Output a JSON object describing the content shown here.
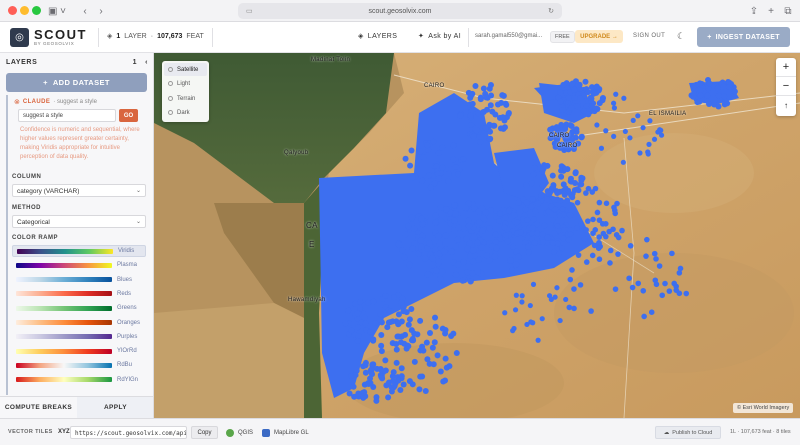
{
  "browser": {
    "url": "scout.geosolvix.com"
  },
  "header": {
    "app_name": "SCOUT",
    "app_sub": "BY GEOSOLVIX",
    "layer_count": "1",
    "layer_word": "LAYER",
    "feature_count": "107,673",
    "feature_word": "FEAT",
    "layers_link": "LAYERS",
    "ask_ai": "Ask by AI",
    "email": "sarah.gamal550@gmai...",
    "plan_badge": "FREE",
    "upgrade": "UPGRADE →",
    "sign_out": "SIGN OUT",
    "ingest": "INGEST DATASET"
  },
  "sidebar": {
    "title": "LAYERS",
    "count": "1",
    "add_dataset": "ADD DATASET",
    "claude_name": "CLAUDE",
    "claude_sub": "· suggest a style",
    "style_input": "suggest a style",
    "go": "GO",
    "claude_note": "Confidence is numeric and sequential, where higher values represent greater certainty, making Viridis appropriate for intuitive perception of data quality.",
    "column_label": "COLUMN",
    "column_value": "category (VARCHAR)",
    "method_label": "METHOD",
    "method_value": "Categorical",
    "ramp_label": "COLOR RAMP",
    "ramps": [
      {
        "name": "Viridis",
        "colors": [
          "#440154",
          "#3b528b",
          "#21918c",
          "#5ec962",
          "#fde725"
        ]
      },
      {
        "name": "Plasma",
        "colors": [
          "#0d0887",
          "#7e03a8",
          "#cc4778",
          "#f89540",
          "#f0f921"
        ]
      },
      {
        "name": "Blues",
        "colors": [
          "#eff3ff",
          "#bdd7e7",
          "#6baed6",
          "#3182bd",
          "#08519c"
        ]
      },
      {
        "name": "Reds",
        "colors": [
          "#fee5d9",
          "#fcae91",
          "#fb6a4a",
          "#de2d26",
          "#a50f15"
        ]
      },
      {
        "name": "Greens",
        "colors": [
          "#edf8e9",
          "#bae4b3",
          "#74c476",
          "#31a354",
          "#006d2c"
        ]
      },
      {
        "name": "Oranges",
        "colors": [
          "#feedde",
          "#fdbe85",
          "#fd8d3c",
          "#e6550d",
          "#a63603"
        ]
      },
      {
        "name": "Purples",
        "colors": [
          "#f2f0f7",
          "#cbc9e2",
          "#9e9ac8",
          "#756bb1",
          "#54278f"
        ]
      },
      {
        "name": "YlOrRd",
        "colors": [
          "#ffffb2",
          "#fecc5c",
          "#fd8d3c",
          "#f03b20",
          "#bd0026"
        ]
      },
      {
        "name": "RdBu",
        "colors": [
          "#ca0020",
          "#f4a582",
          "#f7f7f7",
          "#92c5de",
          "#0571b0"
        ]
      },
      {
        "name": "RdYlGn",
        "colors": [
          "#d7191c",
          "#fdae61",
          "#ffffbf",
          "#a6d96a",
          "#1a9641"
        ]
      }
    ],
    "compute_breaks": "COMPUTE BREAKS",
    "apply": "APPLY"
  },
  "basemaps": {
    "options": [
      "Satellite",
      "Light",
      "Terrain",
      "Dark"
    ],
    "selected": "Satellite"
  },
  "map": {
    "labels": {
      "madinat_tolin": "Madinat Tolin",
      "qalyoub": "Qalyoub",
      "el_ismailia": "EL ISMAILIA",
      "cairo_top": "CAIRO",
      "cairo_mid_1": "CAIRO",
      "cairo_mid_2": "CAIRO",
      "hawamidiye": "Hawamdiyah",
      "ca_partial": "CA",
      "e_partial": "E"
    },
    "point_color": "#3d6ff0",
    "attribution": "© Esri World Imagery"
  },
  "zoom": {
    "in": "+",
    "out": "−",
    "reset": "↑"
  },
  "bottom": {
    "vector_tiles": "VECTOR TILES",
    "xyz": "XYZ",
    "tile_url": "https://scout.geosolvix.com/api/",
    "copy": "Copy",
    "qgis": "QGIS",
    "maplibre": "MapLibre GL",
    "publish": "Publish to Cloud",
    "status": "1L · 107,673 feat · 8 tiles"
  }
}
